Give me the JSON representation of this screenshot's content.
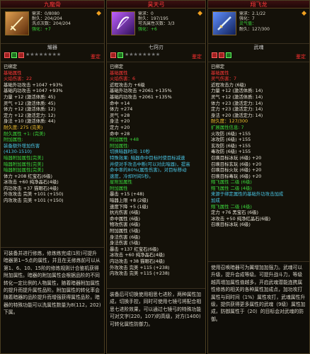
{
  "panels": [
    {
      "title": "九龍骨",
      "icon": "dragon-bone-icon",
      "info": [
        "需求：0/8080",
        "耐久：204/204",
        "洗点次数：204/204",
        "强化：+7"
      ],
      "socket_title": "耀器",
      "tag": "鉴定",
      "lines": [
        {
          "t": "已绑定",
          "c": "w"
        },
        {
          "t": "基础属性",
          "c": "r"
        },
        {
          "t": "火焰伤害：22",
          "c": "r"
        },
        {
          "t": "基础外功攻击 +1047 +93%",
          "c": "w"
        },
        {
          "t": "基础内功攻击 +1047 +93%",
          "c": "w"
        },
        {
          "t": "力量 +12 (激活体质: 45)",
          "c": "w"
        },
        {
          "t": "灵气 +12 (激活体质: 45)",
          "c": "w"
        },
        {
          "t": "体力 +12 (激活体质: 12)",
          "c": "w"
        },
        {
          "t": "定力 +12 (激活定力: 12)",
          "c": "w"
        },
        {
          "t": "身法 +10 (激活体质: 44)",
          "c": "w"
        },
        {
          "t": "耐久度: 275 (完美)",
          "c": "y"
        },
        {
          "t": "耐久属性 +1: (完美)",
          "c": "g"
        },
        {
          "t": "附加属性:",
          "c": "g"
        },
        {
          "t": "装备额外增加伤害",
          "c": "c"
        },
        {
          "t": "(4130-1510)",
          "c": "c"
        },
        {
          "t": "暗器附加属性[完美]",
          "c": "g"
        },
        {
          "t": "暗器附加属性[完美]",
          "c": "g"
        },
        {
          "t": "暗器附加属性[完美]",
          "c": "g"
        },
        {
          "t": "体力 +208 红宝石(6级)",
          "c": "w"
        },
        {
          "t": "冰攻击 +60 纯净晶石(4级)",
          "c": "w"
        },
        {
          "t": "内功攻击 +37 猫眼石(4级)",
          "c": "w"
        },
        {
          "t": "外攻攻击 完美 +101 (+150)",
          "c": "w"
        },
        {
          "t": "内攻攻击 完美 +101 (+150)",
          "c": "w"
        }
      ],
      "foot": "可装备并进行修炼，修炼练完成(1阶)可提升暗器第1~5点的属性，并且在无修炼前可以从第1、6、10、15阶的修炼规则计合鉴机获得附加属性。暗器的附加属性会根据品阶的不同转化一定比例的人物属性，随着暗器附加属性的提升而提升属性品阶。附加属性的转化率会随着暗器的品阶提升而增强获得属性品阶。暗器的特殊功能可以洗属性数量为8(112，202)下属。"
    },
    {
      "title": "昊天弓",
      "icon": "bow-icon",
      "info": [
        "需求：0",
        "耐久：197/195",
        "可洗属性次数：3/3",
        "强化：+6"
      ],
      "socket_title": "七窍刃",
      "tag": "鉴定",
      "lines": [
        {
          "t": "已绑定",
          "c": "w"
        },
        {
          "t": "基础属性",
          "c": "r"
        },
        {
          "t": "火焰伤害：6",
          "c": "r"
        },
        {
          "t": "近程攻击力 +6级",
          "c": "w"
        },
        {
          "t": "基础外功攻击 +2061 +135%",
          "c": "w"
        },
        {
          "t": "基础内功攻击 +2061 +135%",
          "c": "w"
        },
        {
          "t": "命中 +14",
          "c": "w"
        },
        {
          "t": "体力 +274",
          "c": "w"
        },
        {
          "t": "灵气 +28",
          "c": "w"
        },
        {
          "t": "身法 +20",
          "c": "w"
        },
        {
          "t": "定力 +20",
          "c": "w"
        },
        {
          "t": "命中 +28",
          "c": "w"
        },
        {
          "t": "附加属性 +48",
          "c": "g"
        },
        {
          "t": "附加属性:",
          "c": "g"
        },
        {
          "t": "切换暗器时间: 10秒",
          "c": "c"
        },
        {
          "t": "特殊效果: 暗器命中目标时使目标减速",
          "c": "c"
        },
        {
          "t": "并使对手攻击中断(可以对此暗器)，提高",
          "c": "c"
        },
        {
          "t": "命中率的80%(属性伤害)，对目标移动",
          "c": "c"
        },
        {
          "t": "速度，冷却时间5秒。",
          "c": "c"
        },
        {
          "t": "星附加属性",
          "c": "g"
        },
        {
          "t": "附加属性",
          "c": "g"
        },
        {
          "t": "暴击 +15 (+48)",
          "c": "w"
        },
        {
          "t": "暗器上限 +8 (2级)",
          "c": "w"
        },
        {
          "t": "速度下降 +5 (1级)",
          "c": "w"
        },
        {
          "t": "抗光伤害 (6级)",
          "c": "w"
        },
        {
          "t": "命中属性 (6级)",
          "c": "w"
        },
        {
          "t": "物攻伤害 (6级)",
          "c": "w"
        },
        {
          "t": "附加属性 (5级)",
          "c": "w"
        },
        {
          "t": "身法伤害 (6级)",
          "c": "w"
        },
        {
          "t": "身法伤害 (5级)",
          "c": "w"
        },
        {
          "t": "暴击 +137 红宝石(6级)",
          "c": "w"
        },
        {
          "t": "冰攻击 +60 纯净晶石(4级)",
          "c": "w"
        },
        {
          "t": "内功攻击 +38 猫眼石(4级)",
          "c": "w"
        },
        {
          "t": "外攻攻击 完美 +115 (+238)",
          "c": "w"
        },
        {
          "t": "内攻攻击 完美 +115 (+238)",
          "c": "w"
        }
      ],
      "foot": "装备后可切换使用相思七进阶，两种属性加成，切换手控，同时可使用七镜弓将配合相思七进阶效果，可以通过七镜弓的特殊功能可对文字(220，107)的高级，对方(1400)可转化属性防御力。"
    },
    {
      "title": "翔飞龙",
      "icon": "sword-icon",
      "info": [
        "需求：2.1/22",
        "强化：7",
        "灵气值：",
        "耐久：127/300"
      ],
      "socket_title": "武魂",
      "tag": "鉴定",
      "lines": [
        {
          "t": "已绑定",
          "c": "w"
        },
        {
          "t": "基础属性",
          "c": "r"
        },
        {
          "t": "灵气伤害：7",
          "c": "r"
        },
        {
          "t": "近程攻击力 (6级)",
          "c": "w"
        },
        {
          "t": "力量 +12 (激活体质: 14)",
          "c": "w"
        },
        {
          "t": "灵气 +12 (激活体质: 14)",
          "c": "w"
        },
        {
          "t": "体力 +23 (激活定力: 14)",
          "c": "w"
        },
        {
          "t": "定力 +23 (激活定力: 14)",
          "c": "w"
        },
        {
          "t": "身法 +20 (激活定力: 14)",
          "c": "w"
        },
        {
          "t": "耐久度：127/300",
          "c": "y"
        },
        {
          "t": "扩展属性信息: 7",
          "c": "g"
        },
        {
          "t": "火攻防 (6级) +155",
          "c": "w"
        },
        {
          "t": "冰攻防 (6级) +155",
          "c": "w"
        },
        {
          "t": "玄攻防 (6级) +155",
          "c": "w"
        },
        {
          "t": "毒攻防 (6级) +155",
          "c": "w"
        },
        {
          "t": "召唤目标冰玩 (6级) +20",
          "c": "w"
        },
        {
          "t": "召唤目标玄玩 (6级) +20",
          "c": "w"
        },
        {
          "t": "召唤目标火玩 (6级) +20",
          "c": "w"
        },
        {
          "t": "召唤目标毒玩 (6级) +20",
          "c": "w"
        },
        {
          "t": "翔飞属性 二级 (6级)",
          "c": "g"
        },
        {
          "t": "翔飞属性 二级 (4级)",
          "c": "g"
        },
        {
          "t": "来源于绑定属性的基础外功攻击加成",
          "c": "c"
        },
        {
          "t": "加成",
          "c": "c"
        },
        {
          "t": "翔飞属性 二级 (4级)",
          "c": "g"
        },
        {
          "t": "定力 +76 黑宝石 (6级)",
          "c": "w"
        },
        {
          "t": "冰攻击 +50 纯净红晶石(6级)",
          "c": "w"
        },
        {
          "t": "召唤目标冰玩 (6级)",
          "c": "w"
        }
      ],
      "foot": "使用召唤暗器可为翼增加加强力。武魂可以升级，提升会成等级。可提升战斗力，等级越高增加属性值越多，开启武魂潜能连携属性修炼的相关的各种属性加成点，加功攻打属性与同时间（1%）属性攻打，武魂属性升级，提供获得更多属性的武魂（9级）属性加成，防御属性于（20）的目标会对武魂的防御。"
    }
  ]
}
